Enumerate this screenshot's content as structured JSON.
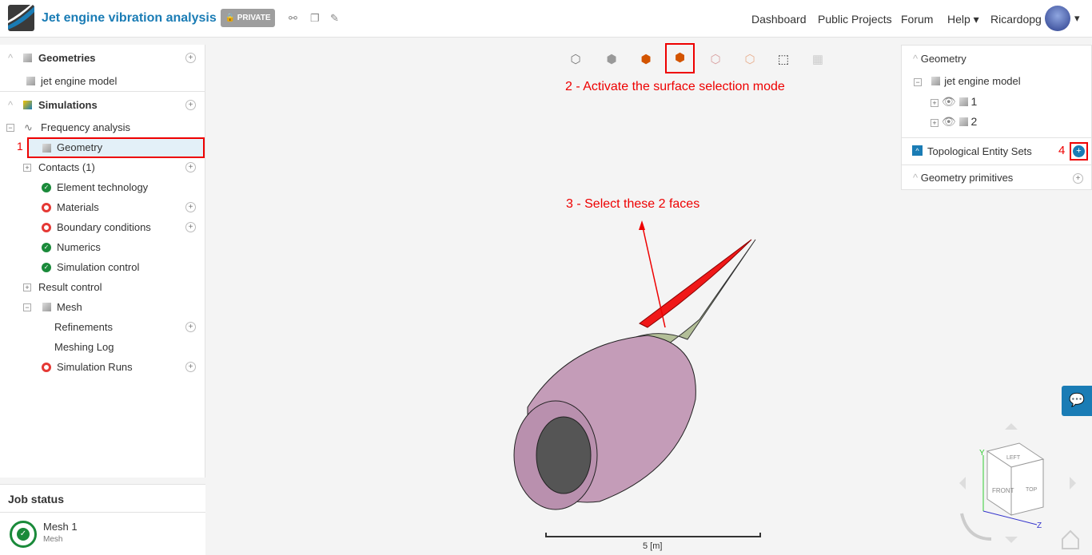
{
  "header": {
    "title": "Jet engine vibration analysis",
    "private": "PRIVATE",
    "nav": [
      "Dashboard",
      "Public Projects",
      "Forum",
      "Help"
    ],
    "user": "Ricardopg"
  },
  "left": {
    "geometries": "Geometries",
    "geometry_model": "jet engine model",
    "simulations": "Simulations",
    "tree": [
      {
        "label": "Frequency analysis"
      },
      {
        "label": "Geometry"
      },
      {
        "label": "Contacts (1)"
      },
      {
        "label": "Element technology"
      },
      {
        "label": "Materials"
      },
      {
        "label": "Boundary conditions"
      },
      {
        "label": "Numerics"
      },
      {
        "label": "Simulation control"
      },
      {
        "label": "Result control"
      },
      {
        "label": "Mesh"
      },
      {
        "label": "Refinements"
      },
      {
        "label": "Meshing Log"
      },
      {
        "label": "Simulation Runs"
      }
    ]
  },
  "job": {
    "title": "Job status",
    "name": "Mesh 1",
    "type": "Mesh"
  },
  "right": {
    "geometry": "Geometry",
    "model": "jet engine model",
    "bodies": [
      "1",
      "2"
    ],
    "tes": "Topological Entity Sets",
    "primitives": "Geometry primitives"
  },
  "annotations": {
    "a1": "1",
    "a2": "2 - Activate the surface selection mode",
    "a3": "3 - Select these 2 faces",
    "a4": "4"
  },
  "viewer": {
    "scale": "5 [m]",
    "cube": {
      "front": "FRONT",
      "left": "LEFT",
      "top": "TOP"
    },
    "axes": {
      "y": "Y",
      "z": "Z"
    }
  },
  "colors": {
    "accent": "#1a7cb5",
    "annotation": "#e00000"
  }
}
